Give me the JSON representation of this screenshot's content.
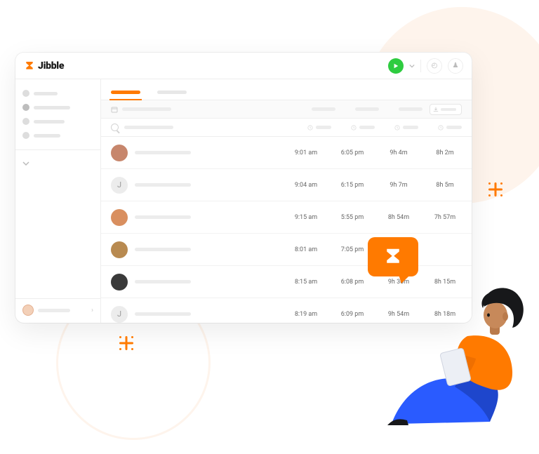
{
  "brand": {
    "name": "Jibble",
    "accent": "#ff7a00",
    "play_color": "#2ecc40"
  },
  "table": {
    "rows": [
      {
        "initial": "",
        "avatar_bg": "#c7866c",
        "in": "9:01 am",
        "out": "6:05 pm",
        "tracked": "9h 4m",
        "worked": "8h 2m"
      },
      {
        "initial": "J",
        "avatar_bg": "#ececec",
        "in": "9:04 am",
        "out": "6:15 pm",
        "tracked": "9h 7m",
        "worked": "8h 5m"
      },
      {
        "initial": "",
        "avatar_bg": "#d98f5f",
        "in": "9:15 am",
        "out": "5:55 pm",
        "tracked": "8h 54m",
        "worked": "7h 57m"
      },
      {
        "initial": "",
        "avatar_bg": "#b88a50",
        "in": "8:01 am",
        "out": "7:05 pm",
        "tracked": "",
        "worked": ""
      },
      {
        "initial": "",
        "avatar_bg": "#3a3a3a",
        "in": "8:15 am",
        "out": "6:08 pm",
        "tracked": "9h 30m",
        "worked": "8h 15m"
      },
      {
        "initial": "J",
        "avatar_bg": "#ececec",
        "in": "8:19 am",
        "out": "6:09 pm",
        "tracked": "9h 54m",
        "worked": "8h 18m"
      }
    ]
  }
}
